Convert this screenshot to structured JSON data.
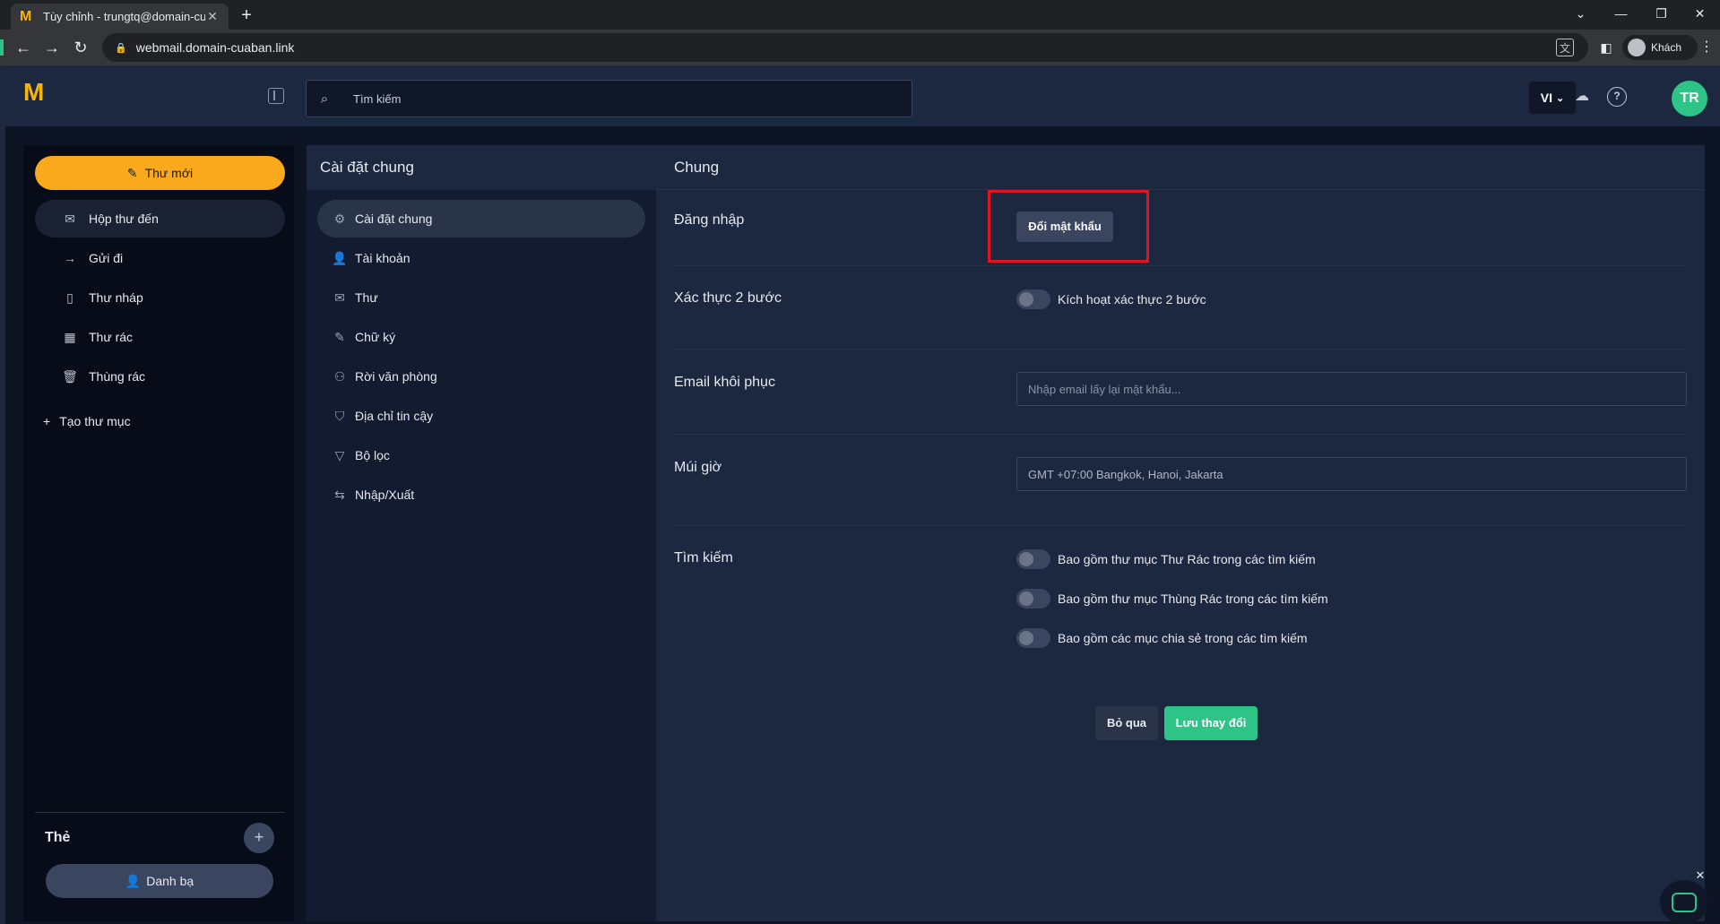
{
  "browser": {
    "tab_title": "Tùy chỉnh - trungtq@domain-cu",
    "url": "webmail.domain-cuaban.link",
    "profile_label": "Khách"
  },
  "header": {
    "search_placeholder": "Tìm kiếm",
    "language": "VI",
    "avatar_initials": "TR"
  },
  "sidebar": {
    "compose_label": "Thư mới",
    "items": [
      {
        "label": "Hộp thư đến",
        "icon": "inbox-icon"
      },
      {
        "label": "Gửi đi",
        "icon": "send-icon"
      },
      {
        "label": "Thư nháp",
        "icon": "draft-icon"
      },
      {
        "label": "Thư rác",
        "icon": "spam-icon"
      },
      {
        "label": "Thùng rác",
        "icon": "trash-icon"
      }
    ],
    "new_folder_label": "Tạo thư mục",
    "tags_title": "Thẻ",
    "contacts_label": "Danh bạ"
  },
  "settings_nav": {
    "title": "Cài đặt chung",
    "items": [
      {
        "label": "Cài đặt chung",
        "icon": "gear-icon"
      },
      {
        "label": "Tài khoản",
        "icon": "user-icon"
      },
      {
        "label": "Thư",
        "icon": "mail-icon"
      },
      {
        "label": "Chữ ký",
        "icon": "signature-icon"
      },
      {
        "label": "Rời văn phòng",
        "icon": "out-of-office-icon"
      },
      {
        "label": "Địa chỉ tin cậy",
        "icon": "shield-icon"
      },
      {
        "label": "Bộ lọc",
        "icon": "filter-icon"
      },
      {
        "label": "Nhập/Xuất",
        "icon": "import-export-icon"
      }
    ]
  },
  "content": {
    "title": "Chung",
    "login_label": "Đăng nhập",
    "change_password_label": "Đổi mật khẩu",
    "twofa_label": "Xác thực 2 bước",
    "twofa_toggle_label": "Kích hoạt xác thực 2 bước",
    "recovery_label": "Email khôi phục",
    "recovery_placeholder": "Nhập email lấy lại mật khẩu...",
    "timezone_label": "Múi giờ",
    "timezone_value": "GMT +07:00 Bangkok, Hanoi, Jakarta",
    "search_label": "Tìm kiếm",
    "search_toggles": [
      "Bao gồm thư mục Thư Rác trong các tìm kiếm",
      "Bao gồm thư mục Thùng Rác trong các tìm kiếm",
      "Bao gồm các mục chia sẻ trong các tìm kiếm"
    ],
    "skip_label": "Bỏ qua",
    "save_label": "Lưu thay đổi"
  },
  "colors": {
    "accent_yellow": "#f9a91b",
    "accent_green": "#2ec487",
    "highlight_red": "#e0141e"
  }
}
